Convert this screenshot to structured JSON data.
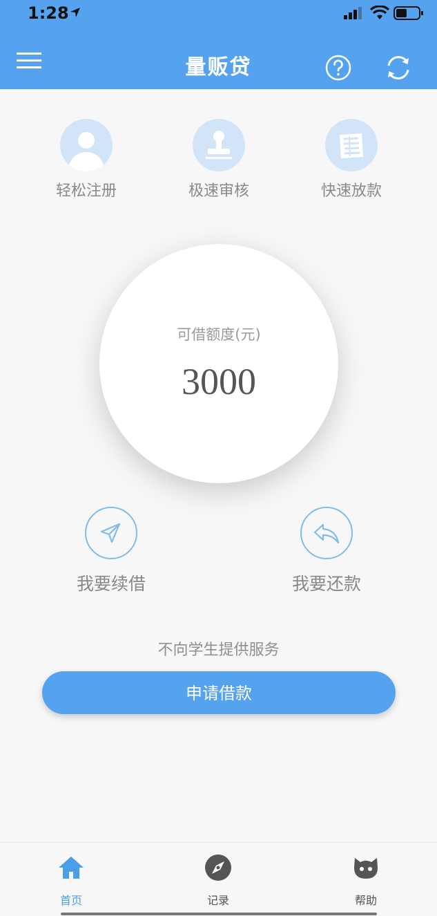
{
  "status_bar": {
    "time": "1:28"
  },
  "nav": {
    "title": "量贩贷"
  },
  "features": [
    {
      "label": "轻松注册",
      "icon": "user-icon"
    },
    {
      "label": "极速审核",
      "icon": "stamp-icon"
    },
    {
      "label": "快速放款",
      "icon": "money-icon"
    }
  ],
  "quota": {
    "label": "可借额度(元)",
    "amount": "3000"
  },
  "actions": {
    "renew_label": "我要续借",
    "repay_label": "我要还款"
  },
  "notice": "不向学生提供服务",
  "apply_button": {
    "label": "申请借款"
  },
  "tabs": [
    {
      "label": "首页",
      "icon": "home-icon",
      "active": true
    },
    {
      "label": "记录",
      "icon": "compass-icon",
      "active": false
    },
    {
      "label": "帮助",
      "icon": "cat-icon",
      "active": false
    }
  ],
  "colors": {
    "brand": "#55a3ef",
    "tab_active": "#4a9fe8",
    "tab_inactive": "#555555",
    "feature_bg": "#d2e4f7"
  }
}
